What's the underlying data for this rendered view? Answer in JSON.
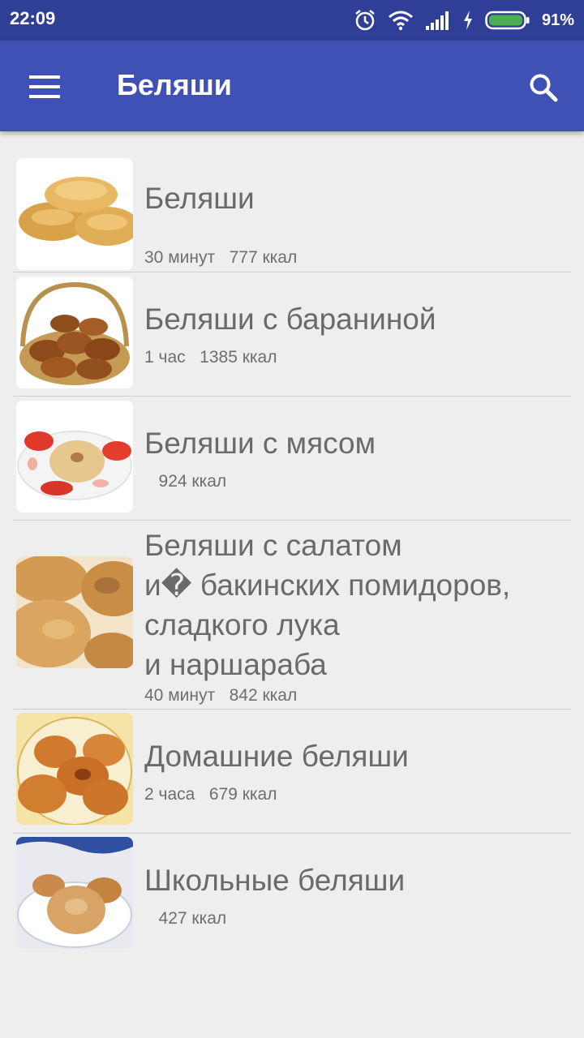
{
  "status": {
    "time": "22:09",
    "battery": "91%",
    "icons": [
      "alarm-icon",
      "wifi-icon",
      "signal-icon",
      "charging-icon",
      "battery-icon"
    ]
  },
  "toolbar": {
    "title": "Беляши",
    "menu_icon": "menu-icon",
    "search_icon": "search-icon"
  },
  "colors": {
    "status_bar": "#2f3f98",
    "toolbar": "#3f51b5",
    "background": "#eeeeee",
    "battery": "#4caf50"
  },
  "recipes": [
    {
      "title": "Беляши",
      "time": "30 минут",
      "kcal": "777 ккал"
    },
    {
      "title": "Беляши с бараниной",
      "time": "1 час",
      "kcal": "1385 ккал"
    },
    {
      "title": "Беляши с мясом",
      "time": "",
      "kcal": "924 ккал"
    },
    {
      "title": "Беляши с салатом\nи� бакинских помидоров,\nсладкого лука\nи наршараба",
      "time": "40 минут",
      "kcal": "842 ккал"
    },
    {
      "title": "Домашние беляши",
      "time": "2 часа",
      "kcal": "679 ккал"
    },
    {
      "title": "Школьные беляши",
      "time": "",
      "kcal": "427 ккал"
    }
  ]
}
